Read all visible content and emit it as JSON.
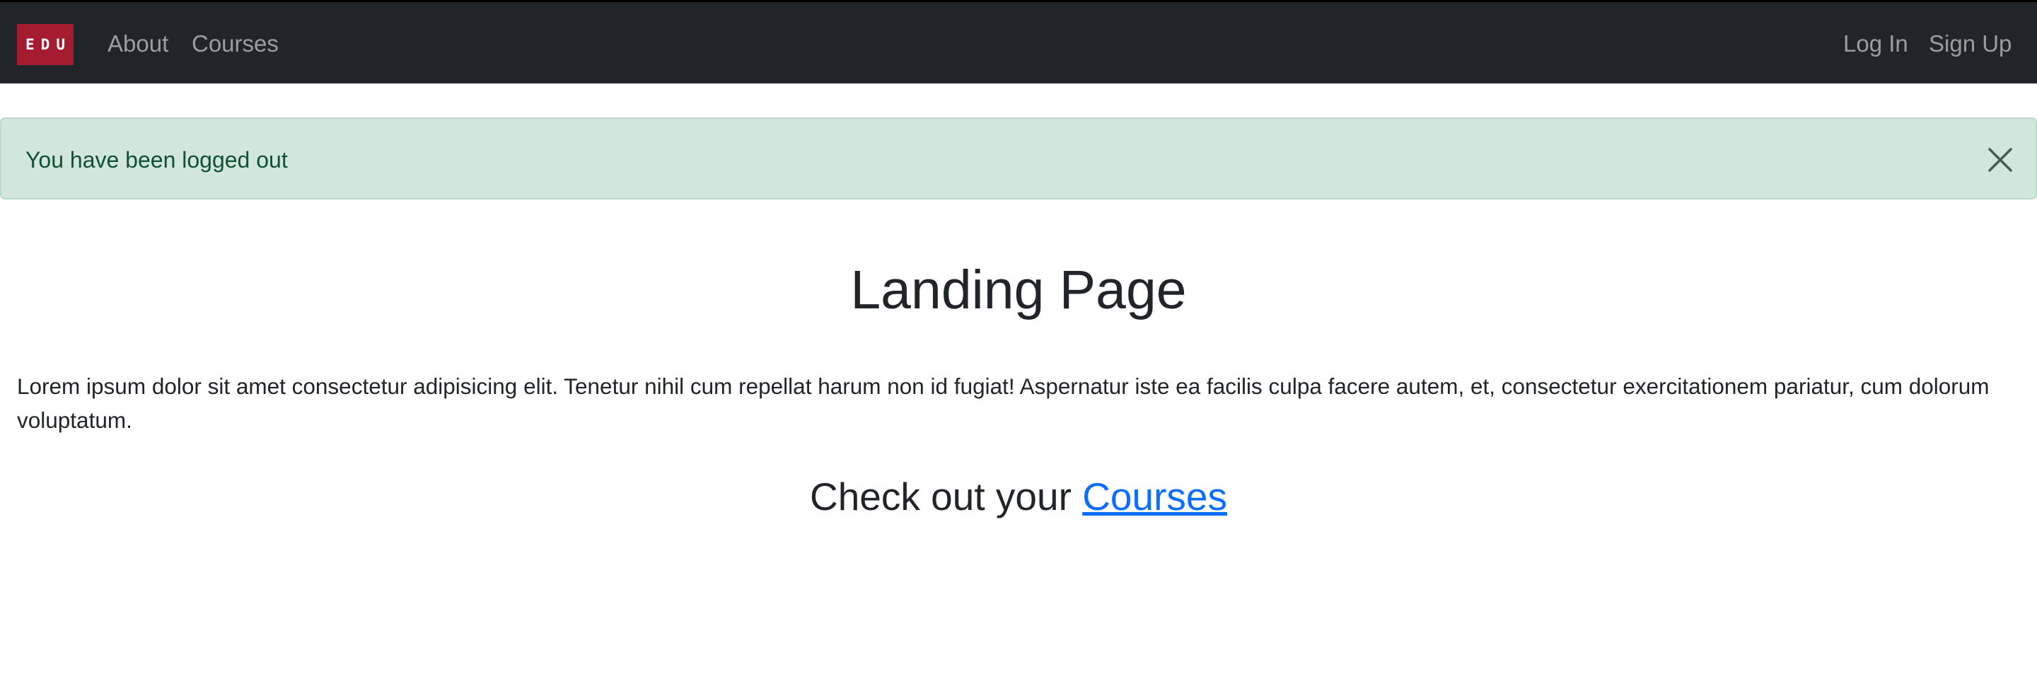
{
  "navbar": {
    "brand": "EDU",
    "links_left": [
      "About",
      "Courses"
    ],
    "links_right": [
      "Log In",
      "Sign Up"
    ]
  },
  "alert": {
    "message": "You have been logged out",
    "close_icon": "close-icon"
  },
  "main": {
    "title": "Landing Page",
    "body": "Lorem ipsum dolor sit amet consectetur adipisicing elit. Tenetur nihil cum repellat harum non id fugiat! Aspernatur iste ea facilis culpa facere autem, et, consectetur exercitationem pariatur, cum dolorum voluptatum.",
    "cta_prefix": "Check out your",
    "cta_link": "Courses"
  },
  "colors": {
    "navbar_bg": "#212529",
    "brand_bg": "#a51c30",
    "alert_bg": "#d1e7dd",
    "alert_text": "#0f5132",
    "link": "#0d6efd"
  }
}
